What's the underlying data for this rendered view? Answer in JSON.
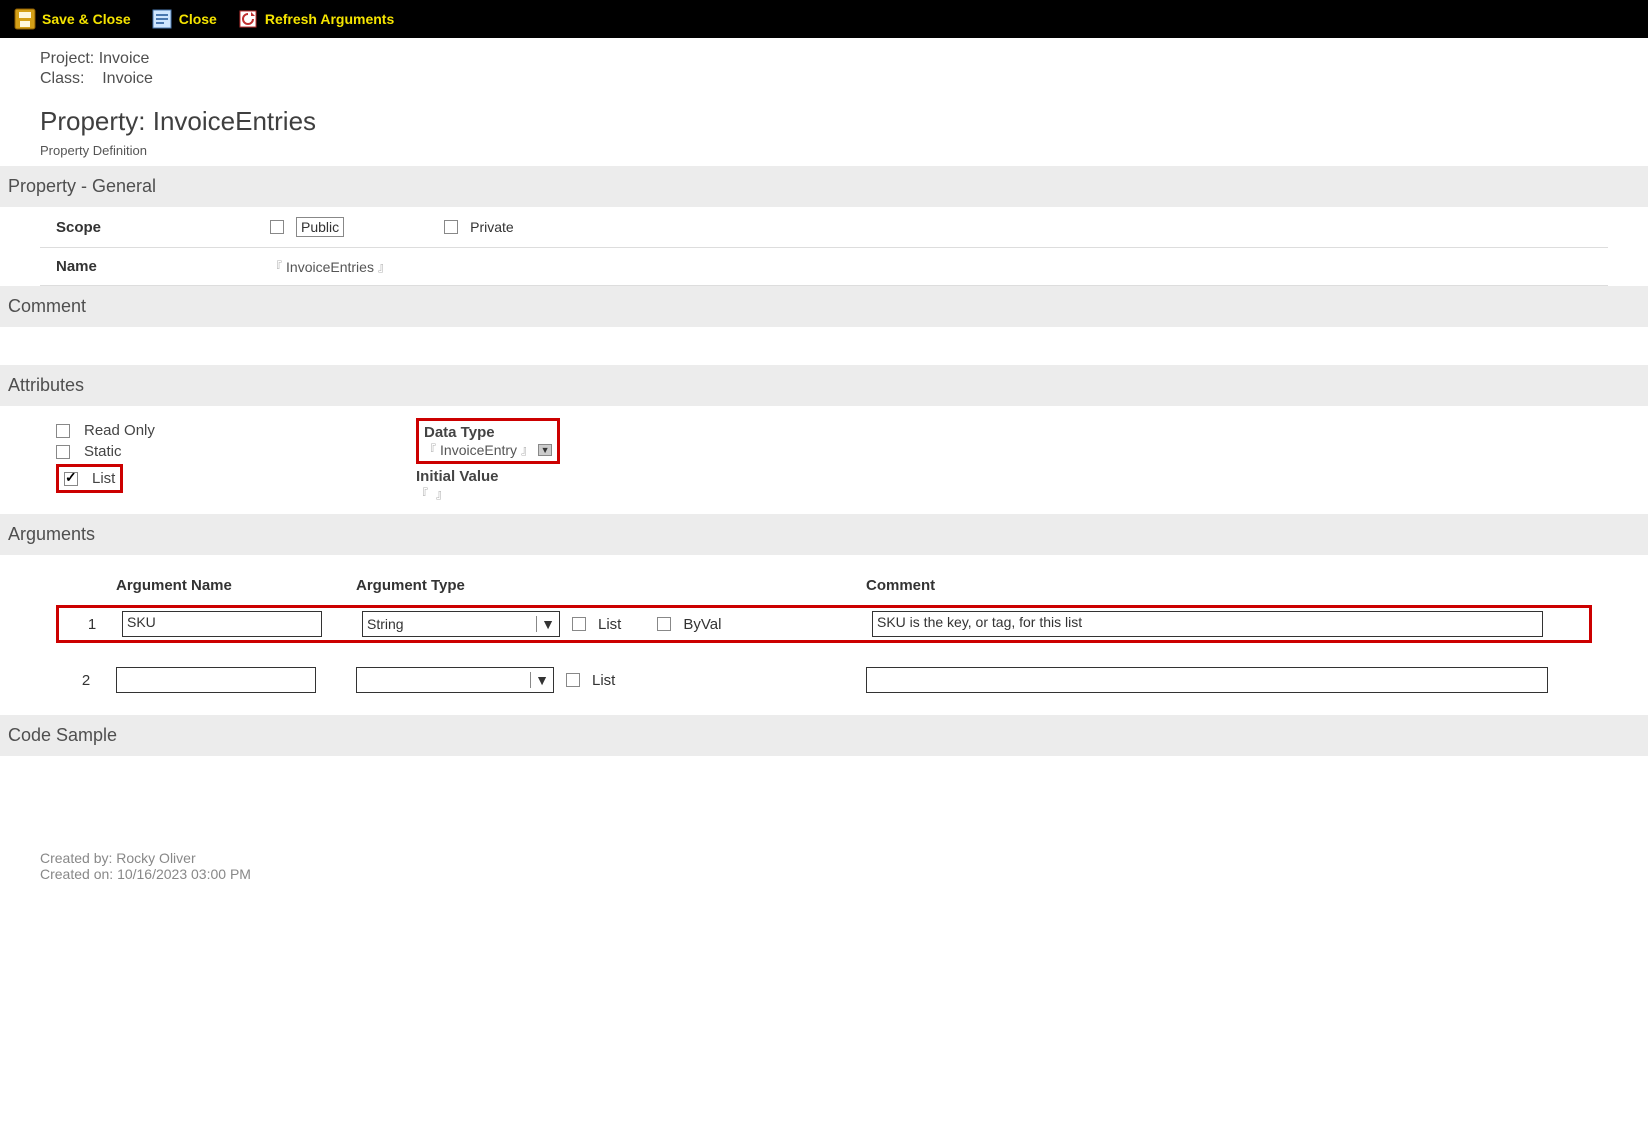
{
  "toolbar": {
    "save_close": "Save & Close",
    "close": "Close",
    "refresh": "Refresh Arguments"
  },
  "meta": {
    "project_label": "Project:",
    "project_value": "Invoice",
    "class_label": "Class:",
    "class_value": "Invoice",
    "title_prefix": "Property:",
    "title_value": "InvoiceEntries",
    "subheading": "Property Definition"
  },
  "sections": {
    "general": "Property - General",
    "comment": "Comment",
    "attributes": "Attributes",
    "arguments": "Arguments",
    "codesample": "Code Sample"
  },
  "general": {
    "scope_label": "Scope",
    "public_label": "Public",
    "private_label": "Private",
    "name_label": "Name",
    "name_value": "InvoiceEntries"
  },
  "attributes": {
    "readonly": "Read Only",
    "static": "Static",
    "list": "List",
    "datatype_label": "Data Type",
    "datatype_value": "InvoiceEntry",
    "initial_label": "Initial Value",
    "initial_value": ""
  },
  "arguments": {
    "headers": {
      "name": "Argument Name",
      "type": "Argument Type",
      "comment": "Comment"
    },
    "flag_list": "List",
    "flag_byval": "ByVal",
    "rows": [
      {
        "num": "1",
        "name": "SKU",
        "type": "String",
        "comment": "SKU is the key, or tag, for this list"
      },
      {
        "num": "2",
        "name": "",
        "type": "",
        "comment": ""
      }
    ]
  },
  "footer": {
    "created_by_label": "Created by:",
    "created_by_value": "Rocky Oliver",
    "created_on_label": "Created on:",
    "created_on_value": "10/16/2023 03:00 PM"
  }
}
